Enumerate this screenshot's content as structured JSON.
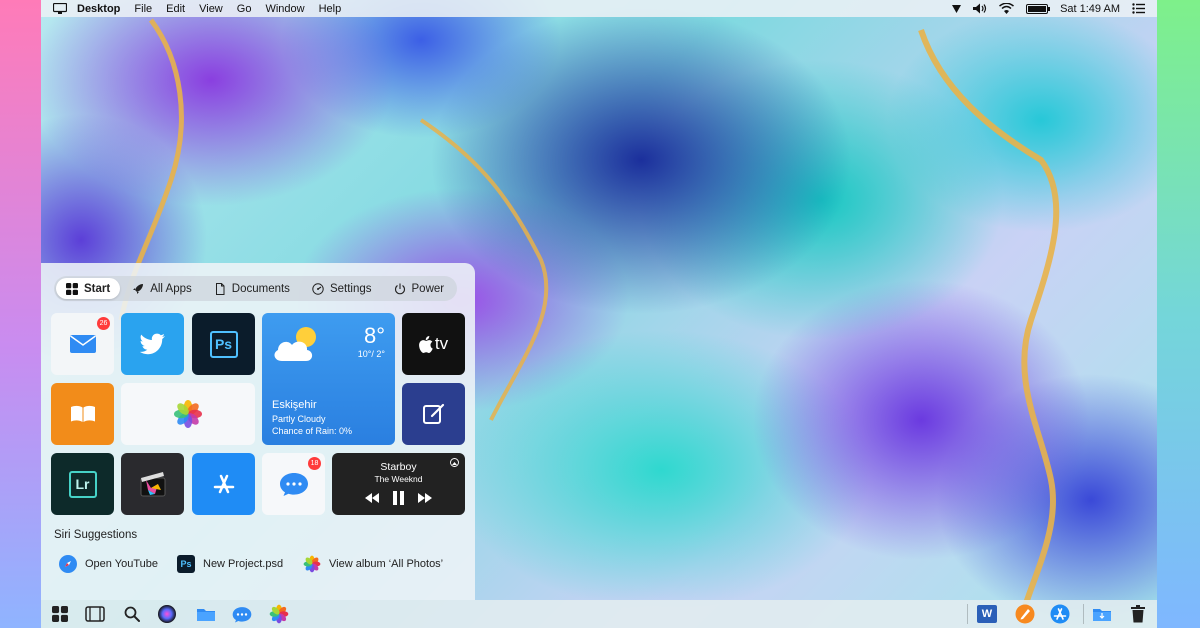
{
  "menubar": {
    "app_name": "Desktop",
    "menus": [
      "File",
      "Edit",
      "View",
      "Go",
      "Window",
      "Help"
    ],
    "clock": "Sat 1:49 AM"
  },
  "start_panel": {
    "tabs": [
      {
        "label": "Start",
        "icon": "grid-icon",
        "active": true
      },
      {
        "label": "All Apps",
        "icon": "rocket-icon",
        "active": false
      },
      {
        "label": "Documents",
        "icon": "document-icon",
        "active": false
      },
      {
        "label": "Settings",
        "icon": "gauge-icon",
        "active": false
      },
      {
        "label": "Power",
        "icon": "power-icon",
        "active": false
      }
    ],
    "tiles": {
      "mail": {
        "badge": "26"
      },
      "photoshop": {
        "label": "Ps"
      },
      "lightroom": {
        "label": "Lr"
      },
      "apple_tv": {
        "label": "tv"
      },
      "messages": {
        "badge": "18"
      }
    },
    "weather": {
      "temp": "8°",
      "range": "10°/ 2°",
      "city": "Eskişehir",
      "condition": "Partly Cloudy",
      "rain": "Chance of Rain: 0%"
    },
    "music": {
      "title": "Starboy",
      "artist": "The Weeknd"
    },
    "siri": {
      "title": "Siri Suggestions",
      "items": [
        {
          "label": "Open YouTube",
          "icon": "safari-icon"
        },
        {
          "label": "New Project.psd",
          "icon": "photoshop-icon",
          "icon_text": "Ps"
        },
        {
          "label": "View album ‘All Photos’",
          "icon": "photos-icon"
        }
      ]
    }
  },
  "dock": {
    "word_label": "W"
  },
  "colors": {
    "twitter": "#2aa3ef",
    "photoshop_bg": "#0b1c2b",
    "photoshop_fg": "#4fc0ff",
    "lightroom_bg": "#0d2a2a",
    "books": "#f28c1a",
    "notes_bg": "#2b3e8f",
    "appstore": "#1f8cf5",
    "weather": "#2e86e8"
  }
}
